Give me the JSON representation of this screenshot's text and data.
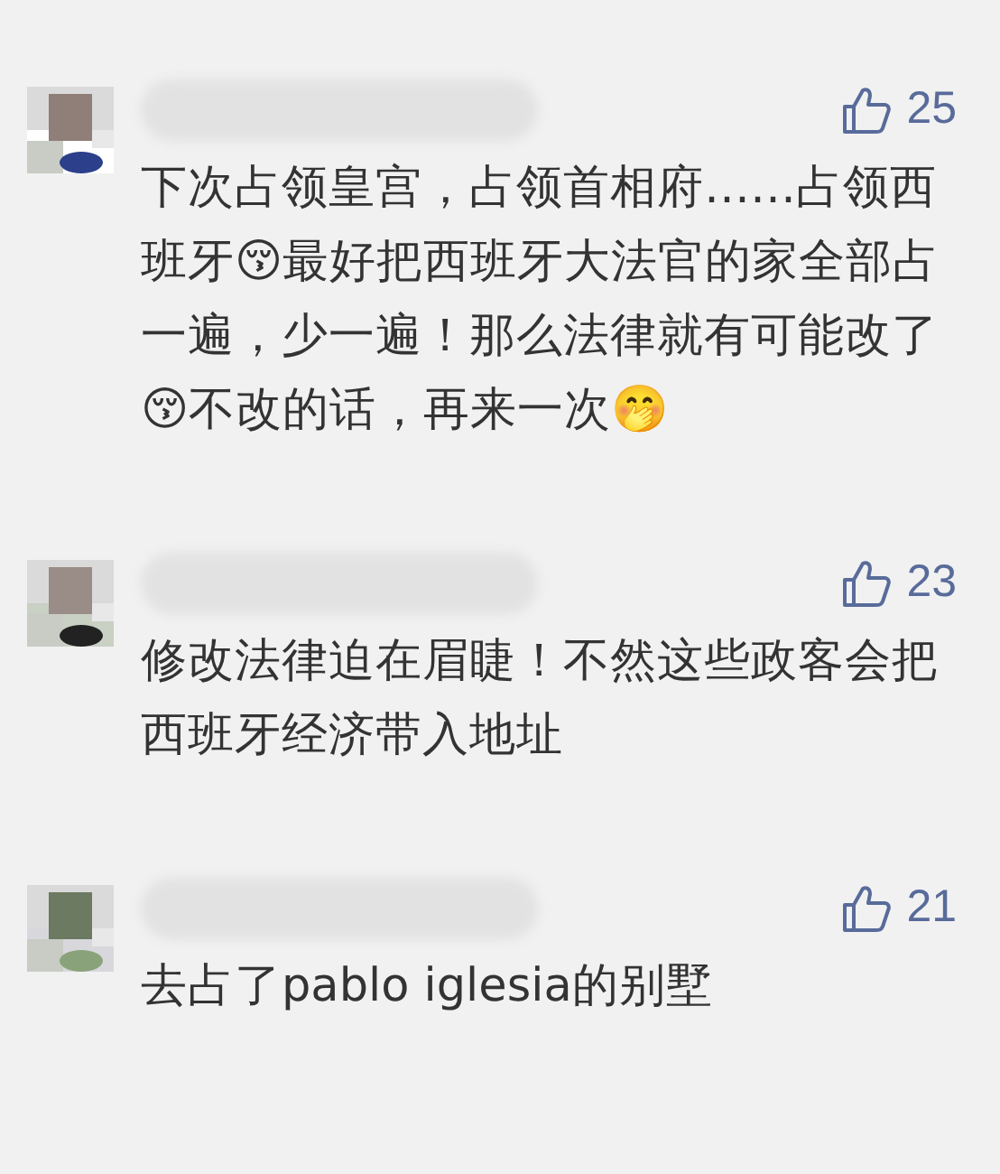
{
  "comments": [
    {
      "likes": "25",
      "text": "下次占领皇宫，占领首相府……占领西班牙😚最好把西班牙大法官的家全部占一遍，少一遍！那么法律就有可能改了😚不改的话，再来一次🤭"
    },
    {
      "likes": "23",
      "text": "修改法律迫在眉睫！不然这些政客会把西班牙经济带入地址"
    },
    {
      "likes": "21",
      "text": "去占了pablo iglesia的别墅"
    }
  ]
}
